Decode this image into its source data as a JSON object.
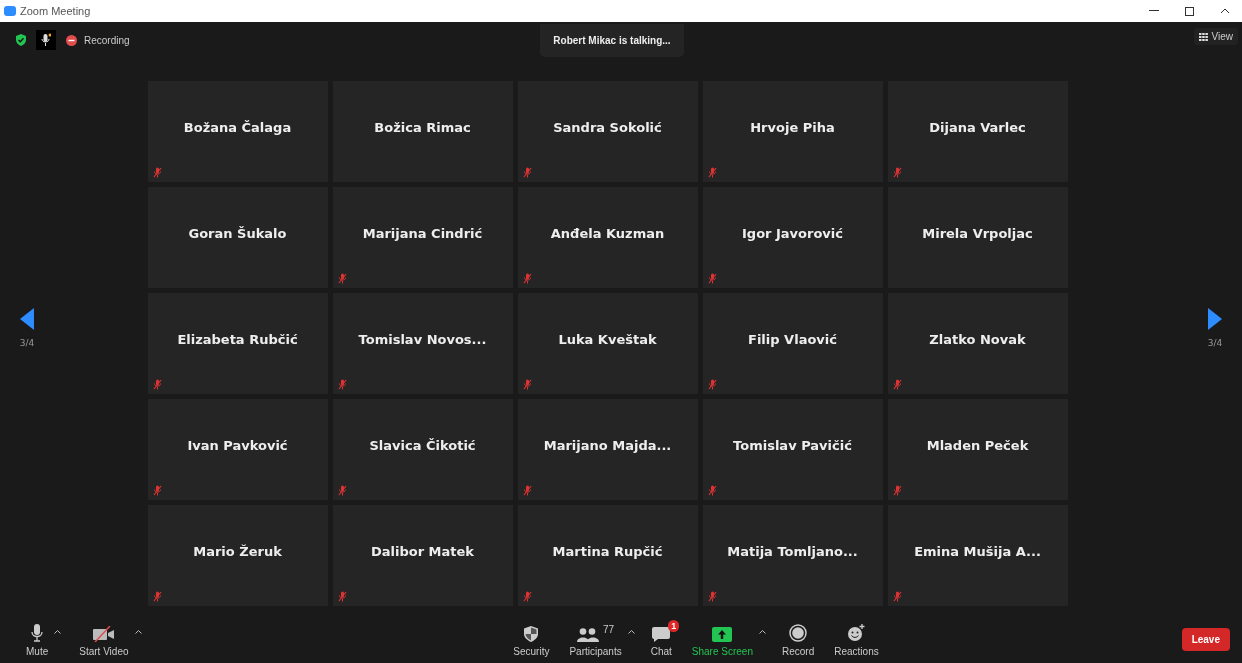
{
  "window": {
    "title": "Zoom Meeting"
  },
  "top_bar": {
    "recording": "Recording",
    "talking": "Robert Mikac is talking...",
    "view": "View"
  },
  "pager": {
    "left": "3/4",
    "right": "3/4"
  },
  "tiles": [
    {
      "name": "Božana Čalaga",
      "muted": true
    },
    {
      "name": "Božica Rimac",
      "muted": false
    },
    {
      "name": "Sandra Sokolić",
      "muted": true
    },
    {
      "name": "Hrvoje Piha",
      "muted": true
    },
    {
      "name": "Dijana Varlec",
      "muted": true
    },
    {
      "name": "Goran Šukalo",
      "muted": false
    },
    {
      "name": "Marijana Cindrić",
      "muted": true
    },
    {
      "name": "Anđela Kuzman",
      "muted": true
    },
    {
      "name": "Igor Javorović",
      "muted": true
    },
    {
      "name": "Mirela Vrpoljac",
      "muted": false
    },
    {
      "name": "Elizabeta Rubčić",
      "muted": true
    },
    {
      "name": "Tomislav  Novos...",
      "muted": true
    },
    {
      "name": "Luka Kveštak",
      "muted": true
    },
    {
      "name": "Filip Vlaović",
      "muted": true
    },
    {
      "name": "Zlatko Novak",
      "muted": true
    },
    {
      "name": "Ivan Pavković",
      "muted": true
    },
    {
      "name": "Slavica Čikotić",
      "muted": true
    },
    {
      "name": "Marijano  Majda...",
      "muted": true
    },
    {
      "name": "Tomislav Pavičić",
      "muted": true
    },
    {
      "name": "Mladen Peček",
      "muted": true
    },
    {
      "name": "Mario Žeruk",
      "muted": true
    },
    {
      "name": "Dalibor Matek",
      "muted": true
    },
    {
      "name": "Martina Rupčić",
      "muted": true
    },
    {
      "name": "Matija  Tomljano...",
      "muted": true
    },
    {
      "name": "Emina  Mušija  A...",
      "muted": true
    }
  ],
  "toolbar": {
    "left": [
      {
        "kind": "mic",
        "label": "Mute",
        "menu": true
      },
      {
        "kind": "video",
        "label": "Start Video",
        "menu": true
      }
    ],
    "center": [
      {
        "kind": "security",
        "label": "Security"
      },
      {
        "kind": "participants",
        "label": "Participants",
        "count": "77",
        "menu": true
      },
      {
        "kind": "chat",
        "label": "Chat",
        "badge": "1"
      },
      {
        "kind": "share",
        "label": "Share Screen",
        "menu": true
      },
      {
        "kind": "record",
        "label": "Record"
      },
      {
        "kind": "reactions",
        "label": "Reactions"
      }
    ],
    "leave": "Leave"
  }
}
